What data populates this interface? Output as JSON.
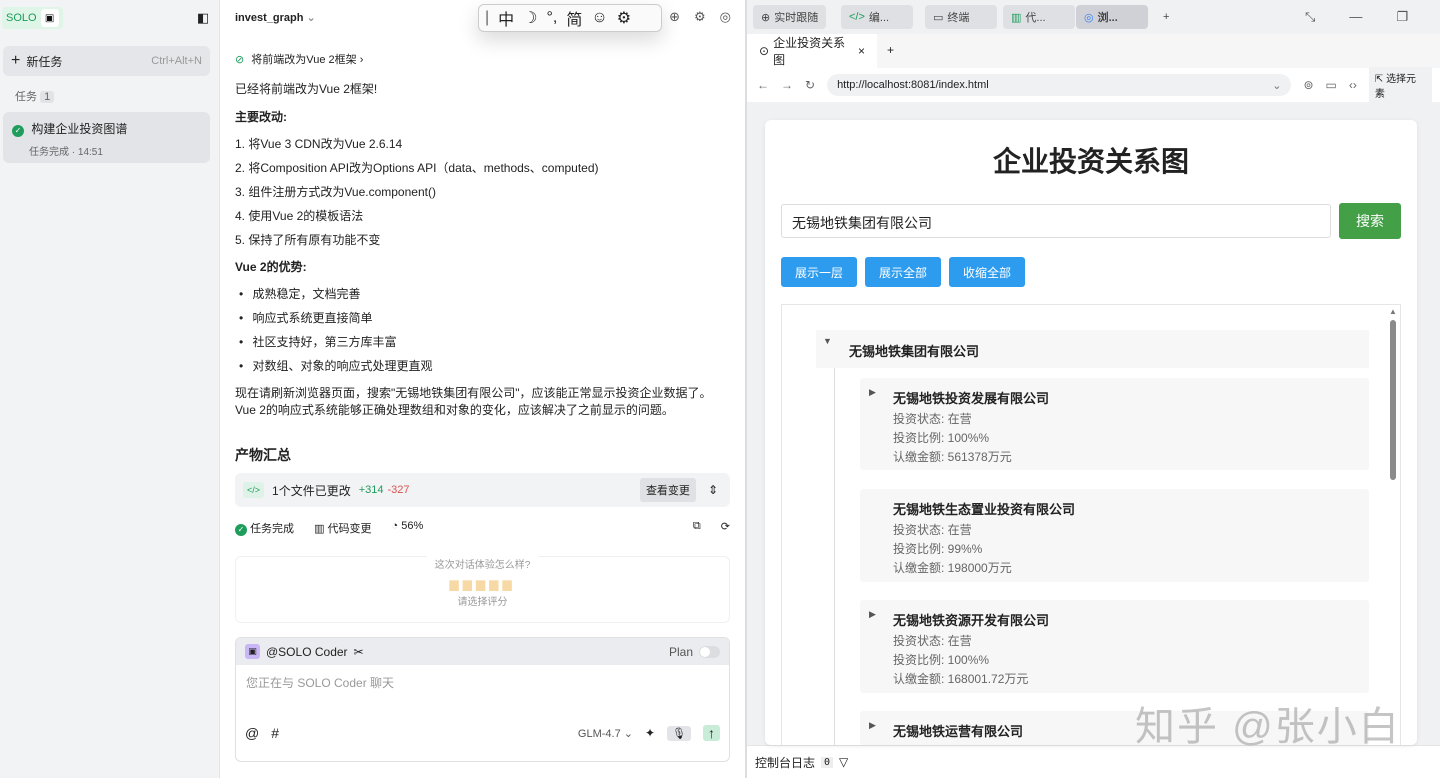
{
  "sidebar": {
    "logo": "SOLO",
    "new_task": "新任务",
    "new_task_shortcut": "Ctrl+Alt+N",
    "tasks_label": "任务",
    "tasks_count": "1",
    "task": {
      "title": "构建企业投资图谱",
      "status": "任务完成 · 14:51"
    }
  },
  "chat": {
    "project": "invest_graph",
    "step": "将前端改为Vue 2框架",
    "intro": "已经将前端改为Vue 2框架!",
    "changes_title": "主要改动:",
    "changes": [
      "1. 将Vue 3 CDN改为Vue 2.6.14",
      "2. 将Composition API改为Options API（data、methods、computed)",
      "3. 组件注册方式改为Vue.component()",
      "4. 使用Vue 2的模板语法",
      "5. 保持了所有原有功能不变"
    ],
    "adv_title": "Vue 2的优势:",
    "advantages": [
      "成熟稳定，文档完善",
      "响应式系统更直接简单",
      "社区支持好，第三方库丰富",
      "对数组、对象的响应式处理更直观"
    ],
    "conclusion": "现在请刷新浏览器页面，搜索\"无锡地铁集团有限公司\"，应该能正常显示投资企业数据了。Vue 2的响应式系统能够正确处理数组和对象的变化，应该解决了之前显示的问题。",
    "summary_title": "产物汇总",
    "files_changed": "1个文件已更改",
    "added": "+314",
    "removed": "-327",
    "view_changes": "查看变更",
    "status_done": "任务完成",
    "code_changes": "代码变更",
    "progress": "56%",
    "rating_q": "这次对话体验怎么样?",
    "rating_hint": "请选择评分",
    "agent": "@SOLO Coder",
    "plan": "Plan",
    "input_placeholder": "您正在与 SOLO Coder 聊天",
    "model": "GLM-4.7"
  },
  "ime": {
    "items": [
      "中",
      "☽",
      "°,",
      "简",
      "☺",
      "⚙"
    ]
  },
  "right": {
    "tabs": [
      "实时跟随",
      "编...",
      "终端",
      "代...",
      "浏..."
    ],
    "browser_tab": "企业投资关系图",
    "url": "http://localhost:8081/index.html",
    "select_element": "选择元素",
    "console": "控制台日志",
    "console_count": "0"
  },
  "page": {
    "title": "企业投资关系图",
    "search_value": "无锡地铁集团有限公司",
    "search_btn": "搜索",
    "btn_one": "展示一层",
    "btn_all": "展示全部",
    "btn_collapse": "收缩全部",
    "root": "无锡地铁集团有限公司",
    "children": [
      {
        "name": "无锡地铁投资发展有限公司",
        "status": "投资状态: 在营",
        "ratio": "投资比例: 100%%",
        "amount": "认缴金额: 561378万元"
      },
      {
        "name": "无锡地铁生态置业投资有限公司",
        "status": "投资状态: 在营",
        "ratio": "投资比例: 99%%",
        "amount": "认缴金额: 198000万元"
      },
      {
        "name": "无锡地铁资源开发有限公司",
        "status": "投资状态: 在营",
        "ratio": "投资比例: 100%%",
        "amount": "认缴金额: 168001.72万元"
      },
      {
        "name": "无锡地铁运营有限公司"
      }
    ],
    "watermark": "知乎 @张小白"
  }
}
